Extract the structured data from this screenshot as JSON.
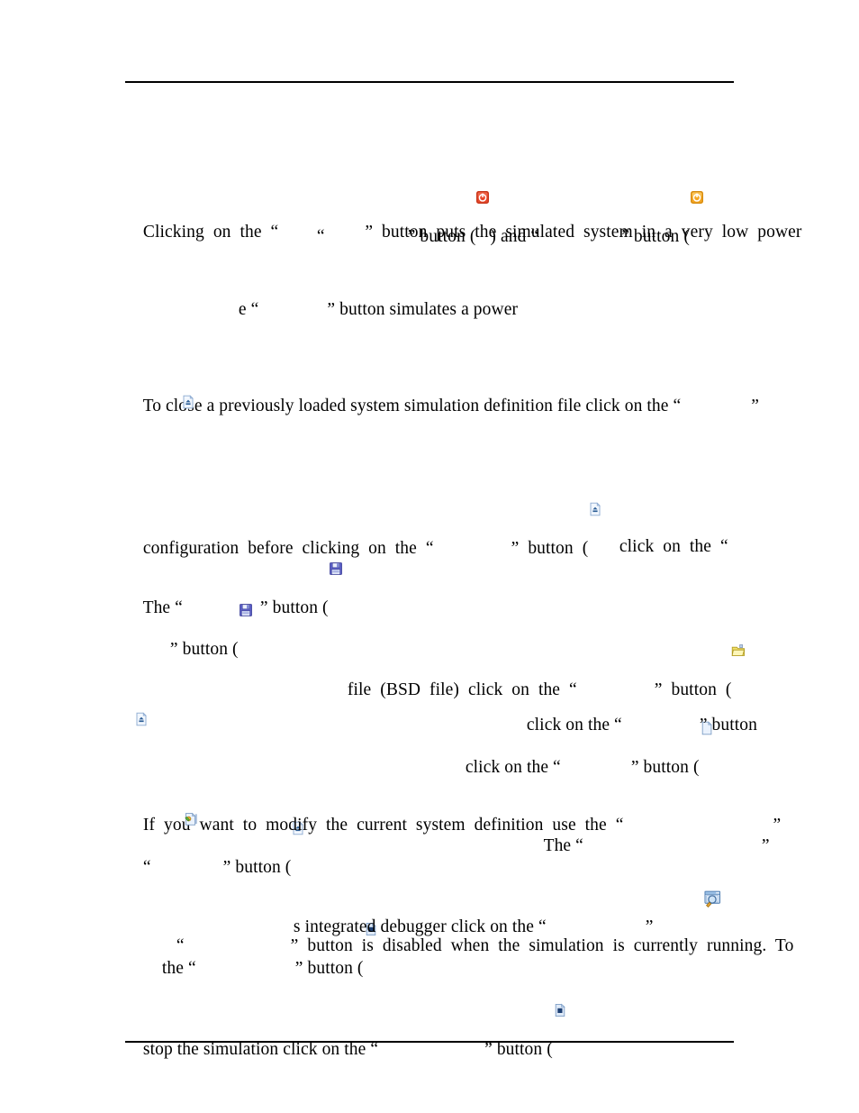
{
  "document": {
    "type": "manual-page",
    "background_color": "#ffffff",
    "text_color": "#000000",
    "rules": {
      "header_rule": "horizontal-rule",
      "footer_rule": "horizontal-rule"
    }
  },
  "icons": {
    "power_off": {
      "name": "power-off-icon",
      "label": "power off button icon",
      "fill": "#e8482b",
      "glyph": "power-symbol-red-square"
    },
    "power_on": {
      "name": "power-on-icon",
      "label": "power on button icon",
      "fill": "#f5a623",
      "glyph": "power-symbol-orange-square"
    },
    "eject_doc": {
      "name": "close-document-icon",
      "label": "close configuration button icon",
      "fill": "#c3d4ee",
      "glyph": "document-with-eject-arrow"
    },
    "save_floppy": {
      "name": "save-icon",
      "label": "save button icon",
      "fill": "#5b5fc7",
      "glyph": "floppy-disk"
    },
    "open_folder": {
      "name": "open-folder-icon",
      "label": "open BSD file button icon",
      "fill": "#f2e06a",
      "glyph": "open-folder"
    },
    "new_doc": {
      "name": "new-document-icon",
      "label": "new button icon",
      "fill": "#dce8f8",
      "glyph": "blank-page"
    },
    "plugin_doc": {
      "name": "modify-definition-icon",
      "label": "modify system definition button icon",
      "fill": "#cfe0f5",
      "glyph": "document-with-green-plug"
    },
    "stop_doc": {
      "name": "stop-simulation-icon",
      "label": "stop button icon",
      "fill": "#cfe0f5",
      "glyph": "document-with-dark-square"
    },
    "debugger": {
      "name": "debugger-icon",
      "label": "integrated debugger button icon",
      "fill": "#d8e8f8",
      "glyph": "window-with-magnifier"
    }
  },
  "body": {
    "line1": {
      "quote_open": "“",
      "redacted1": "",
      "quote_close": "”",
      "button_word": " button (",
      "close_paren": ") and ",
      "quote_open2": "“",
      "redacted2": "",
      "quote_close2": "”",
      "button_word2": " button ("
    },
    "line2": {
      "text_start": "Clicking  on  the  “",
      "redacted": "",
      "text_end": "”  button  puts  the  simulated  system  in  a  very  low  power"
    },
    "line3": {
      "text_start": "e “",
      "redacted": "",
      "text_end": "” button simulates a power"
    },
    "line4": {
      "text_start": "To close a previously loaded system simulation definition file click on the “",
      "redacted": "",
      "text_end": "”"
    },
    "line5": {
      "text_start": "configuration  before  clicking  on  the  “",
      "redacted": "",
      "text_end": "”  button  ("
    },
    "line6": {
      "text_start": "The “",
      "redacted": "",
      "text_end": "” button ("
    },
    "line7": {
      "text": "click  on  the  “"
    },
    "line8": {
      "text_start": "” button (",
      "text_end": ""
    },
    "line9": {
      "text_start": "file  (BSD  file)  click  on  the  “",
      "redacted": "",
      "text_end": "”  button  ("
    },
    "line10": {
      "text_start": "click on the “",
      "redacted": "",
      "text_end": "” button ("
    },
    "line11": {
      "text_start": "click on the “",
      "redacted": "",
      "text_end": "” button"
    },
    "line12": {
      "text_start": "“",
      "redacted": "",
      "text_end": "” button ("
    },
    "line13": {
      "text_start": "If  you  want  to  modify  the  current  system  definition  use  the  “",
      "redacted": "",
      "text_end": "”"
    },
    "line14": {
      "text_start": "The “",
      "redacted": "",
      "text_end": "”"
    },
    "line15": {
      "text_start": "the “",
      "redacted": "",
      "text_end": "” button ("
    },
    "line16": {
      "text_start": "s integrated debugger click on the “",
      "redacted": "",
      "text_end": "”"
    },
    "line17": {
      "text_start": "“",
      "redacted": "",
      "text_end": "”  button  is  disabled  when  the  simulation  is  currently  running.  To"
    },
    "line18": {
      "text_start": "stop the simulation click on the “",
      "redacted": "",
      "text_end": "” button ("
    }
  }
}
